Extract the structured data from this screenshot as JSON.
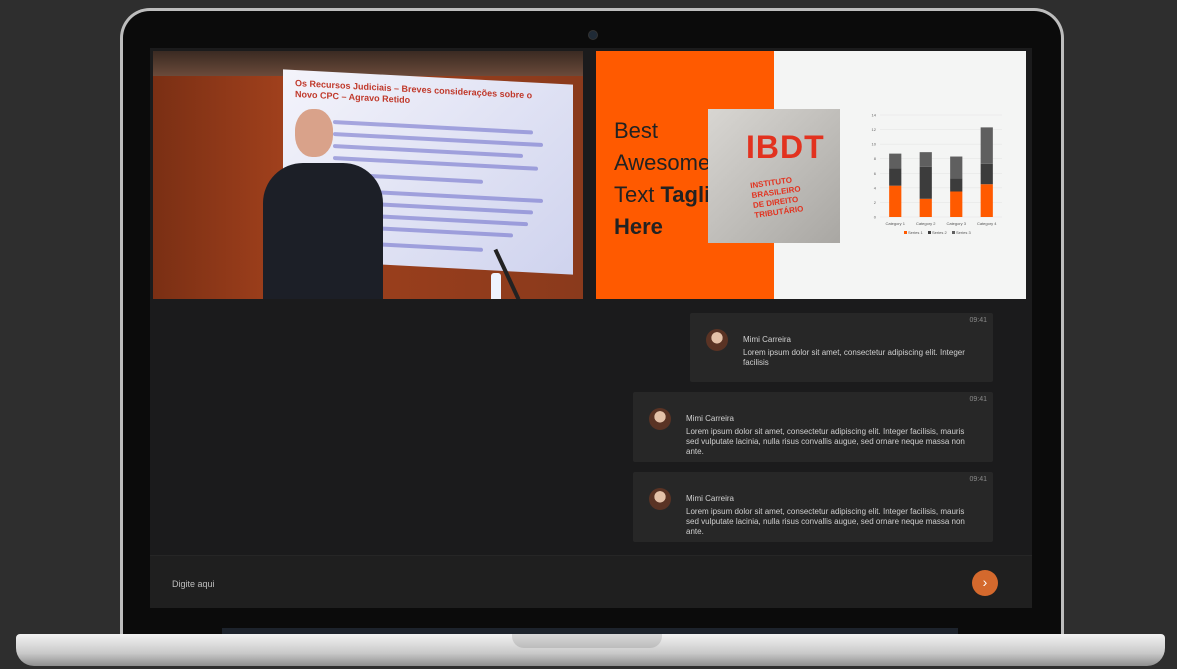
{
  "video_left": {
    "slide_title": "Os Recursos Judiciais – Breves considerações sobre o Novo CPC – Agravo Retido"
  },
  "video_right": {
    "tagline_line1": "Best",
    "tagline_line2": "Awesome",
    "tagline_line3a": "Text",
    "tagline_line3b": "Tagline",
    "tagline_line4": "Here",
    "logo_text": "IBDT",
    "logo_sub_1": "INSTITUTO BRASILEIRO",
    "logo_sub_2": "DE DIREITO TRIBUTÁRIO",
    "accent": "#ff5a00"
  },
  "chart_data": {
    "type": "bar",
    "categories": [
      "Category 1",
      "Category 2",
      "Category 3",
      "Category 4"
    ],
    "series": [
      {
        "name": "Series 1",
        "values": [
          4.3,
          2.5,
          3.5,
          4.5
        ],
        "color": "#ff5a00"
      },
      {
        "name": "Series 2",
        "values": [
          2.4,
          4.4,
          1.8,
          2.8
        ],
        "color": "#3c3c3c"
      },
      {
        "name": "Series 3",
        "values": [
          2.0,
          2.0,
          3.0,
          5.0
        ],
        "color": "#5f5f5f"
      }
    ],
    "ylim": [
      0,
      14
    ],
    "y_ticks": [
      "0",
      "2",
      "4",
      "6",
      "8",
      "10",
      "12",
      "14"
    ],
    "legend": "bottom"
  },
  "messages": [
    {
      "time": "09:41",
      "name": "Mimi Carreira",
      "text": "Lorem ipsum dolor sit amet, consectetur adipiscing elit. Integer facilisis"
    },
    {
      "time": "09:41",
      "name": "Mimi Carreira",
      "text": "Lorem ipsum dolor sit amet, consectetur adipiscing elit. Integer facilisis, mauris sed vulputate lacinia, nulla risus convallis augue, sed ornare neque massa non ante."
    },
    {
      "time": "09:41",
      "name": "Mimi Carreira",
      "text": "Lorem ipsum dolor sit amet, consectetur adipiscing elit. Integer facilisis, mauris sed vulputate lacinia, nulla risus convallis augue, sed ornare neque massa non ante."
    }
  ],
  "input": {
    "placeholder": "Digite aqui",
    "send_icon": "chevron-right-icon",
    "send_color": "#d4692d"
  }
}
